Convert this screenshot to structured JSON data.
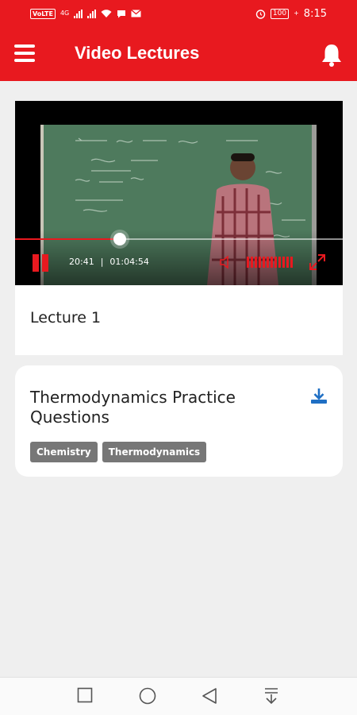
{
  "status_bar": {
    "volte": "VoLTE",
    "network_type": "4G",
    "battery": "100",
    "time": "8:15"
  },
  "app_bar": {
    "title": "Video Lectures",
    "menu_icon": "hamburger-menu-icon",
    "bell_icon": "bell-icon"
  },
  "video": {
    "current_time": "20:41",
    "separator": "|",
    "duration": "01:04:54",
    "progress": 0.319,
    "volume_level": 1.0,
    "lecture_title": "Lecture 1"
  },
  "practice": {
    "title": "Thermodynamics Practice Questions",
    "download_icon": "download-icon",
    "tags": [
      "Chemistry",
      "Thermodynamics"
    ]
  },
  "colors": {
    "brand_red": "#e8191f",
    "tag_gray": "#777777",
    "download_blue": "#1f6fc4",
    "page_bg": "#efefef"
  }
}
